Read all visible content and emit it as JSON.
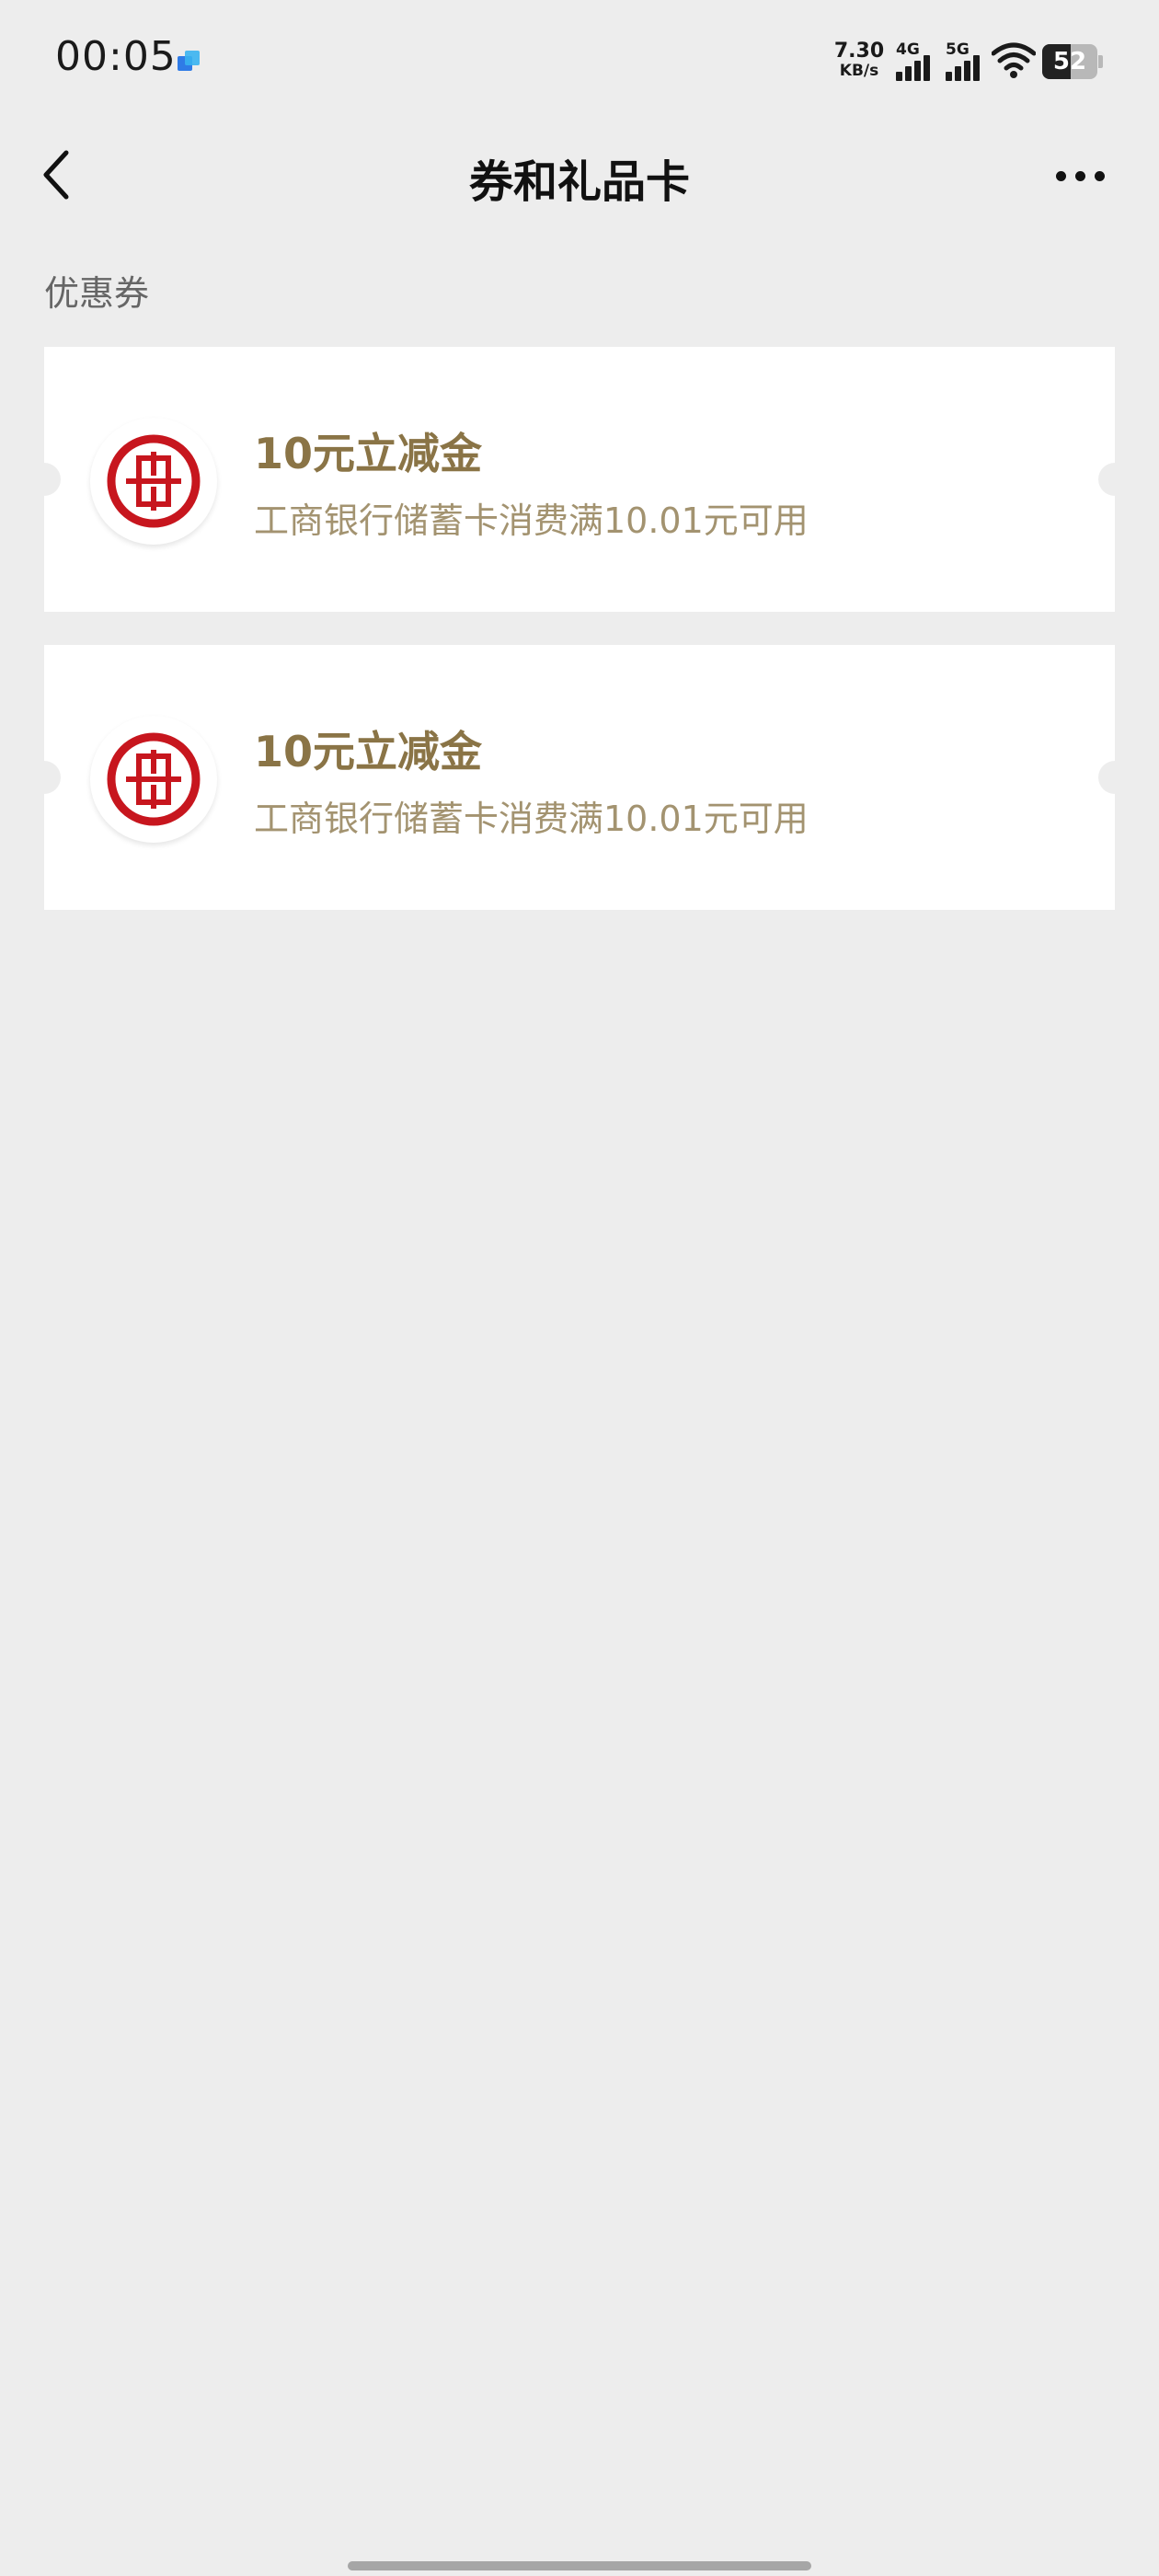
{
  "status_bar": {
    "time": "00:05",
    "net_speed_value": "7.30",
    "net_speed_unit": "KB/s",
    "signal_1_label": "4G",
    "signal_2_label": "5G",
    "battery_level": "52",
    "battery_fraction": 0.52,
    "app_icon": "app-notification-icon"
  },
  "nav": {
    "back_icon": "chevron-left-icon",
    "title": "券和礼品卡",
    "more_icon": "more-dots-icon"
  },
  "section": {
    "title": "优惠券"
  },
  "coupons": [
    {
      "title": "10元立减金",
      "description": "工商银行储蓄卡消费满10.01元可用",
      "logo_icon": "icbc-logo-icon"
    },
    {
      "title": "10元立减金",
      "description": "工商银行储蓄卡消费满10.01元可用",
      "logo_icon": "icbc-logo-icon"
    }
  ],
  "colors": {
    "background": "#ededed",
    "card": "#ffffff",
    "coupon_title": "#8a7446",
    "coupon_desc": "#a39370",
    "icbc_red": "#c7161e"
  }
}
